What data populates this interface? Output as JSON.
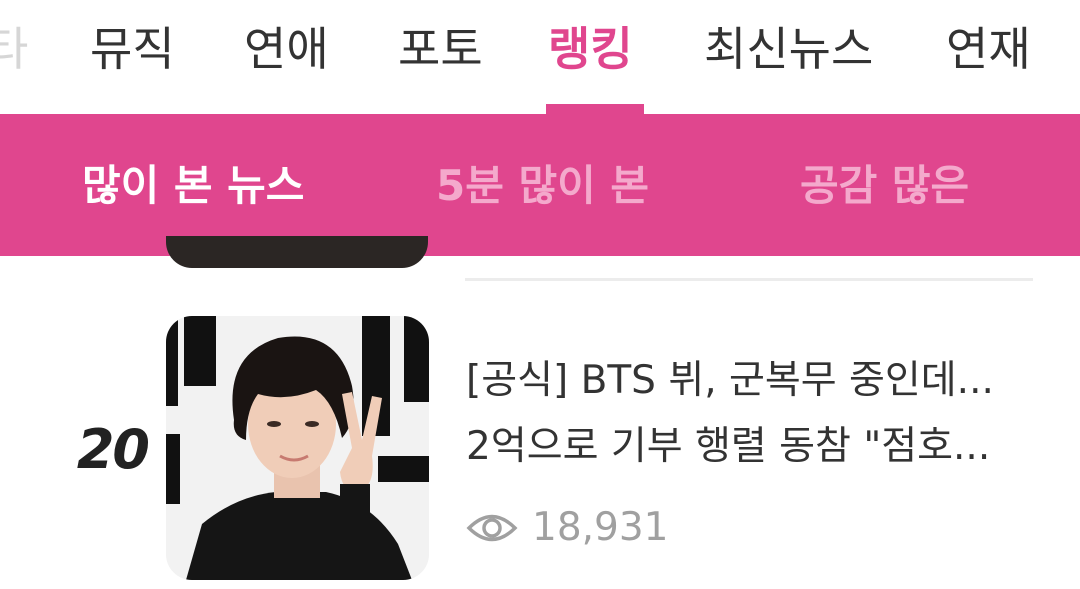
{
  "top_tabs": [
    {
      "label": "타"
    },
    {
      "label": "뮤직"
    },
    {
      "label": "연애"
    },
    {
      "label": "포토"
    },
    {
      "label": "랭킹"
    },
    {
      "label": "최신뉴스"
    },
    {
      "label": "연재"
    }
  ],
  "sub_tabs": [
    {
      "label": "많이 본 뉴스"
    },
    {
      "label": "5분 많이 본"
    },
    {
      "label": "공감 많은"
    }
  ],
  "article": {
    "rank": "20",
    "title_line1": "[공식] BTS 뷔, 군복무 중인데...",
    "title_line2": "2억으로 기부 행렬 동참 \"점호...",
    "views": "18,931",
    "icon": "eye-icon"
  },
  "colors": {
    "accent": "#e0468e",
    "inactive_sub": "#f4a9cc",
    "text": "#333333",
    "muted": "#a0a0a0"
  }
}
